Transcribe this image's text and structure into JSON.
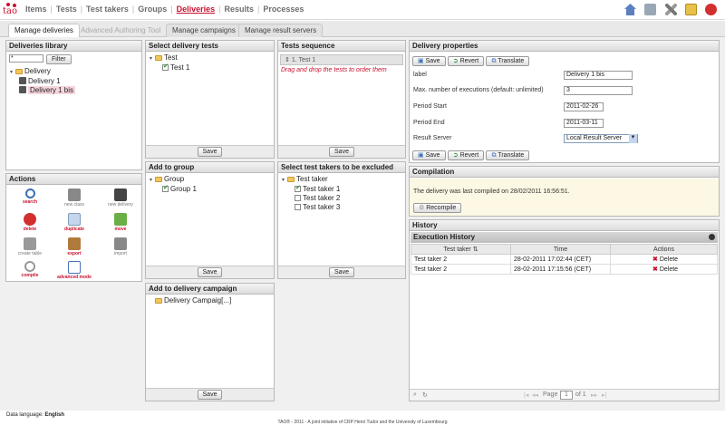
{
  "app": {
    "logo_text": "tao"
  },
  "nav": {
    "items": [
      "Items",
      "Tests",
      "Test takers",
      "Groups",
      "Deliveries",
      "Results",
      "Processes"
    ],
    "active": "Deliveries"
  },
  "toolbar_icons": [
    "home-icon",
    "user-settings-icon",
    "tools-icon",
    "notes-icon",
    "logout-icon"
  ],
  "tabs": [
    "Manage deliveries",
    "Advanced Authoring Tool",
    "Manage campaigns",
    "Manage result servers"
  ],
  "library": {
    "title": "Deliveries library",
    "filter_value": "*",
    "filter_label": "Filter",
    "root": "Delivery",
    "items": [
      "Delivery 1",
      "Delivery 1 bis"
    ]
  },
  "actions": {
    "title": "Actions",
    "items": [
      {
        "label": "search",
        "icon": "magnifier-icon"
      },
      {
        "label": "new class",
        "icon": "folder-icon"
      },
      {
        "label": "new delivery",
        "icon": "delivery-icon"
      },
      {
        "label": "delete",
        "icon": "delete-icon"
      },
      {
        "label": "duplicate",
        "icon": "duplicate-icon"
      },
      {
        "label": "move",
        "icon": "move-icon"
      },
      {
        "label": "create table",
        "icon": "table-icon"
      },
      {
        "label": "export",
        "icon": "export-icon"
      },
      {
        "label": "import",
        "icon": "import-icon"
      },
      {
        "label": "compile",
        "icon": "compile-icon"
      },
      {
        "label": "advanced mode",
        "icon": "advanced-mode-icon"
      }
    ]
  },
  "select_tests": {
    "title": "Select delivery tests",
    "folder": "Test",
    "items": [
      "Test 1"
    ],
    "save": "Save"
  },
  "tests_sequence": {
    "title": "Tests sequence",
    "item": "1. Test 1",
    "hint": "Drag and drop the tests to order them",
    "save": "Save"
  },
  "add_group": {
    "title": "Add to group",
    "folder": "Group",
    "items": [
      "Group 1"
    ],
    "save": "Save"
  },
  "exclude": {
    "title": "Select test takers to be excluded",
    "folder": "Test taker",
    "items": [
      "Test taker 1",
      "Test taker 2",
      "Test taker 3"
    ],
    "save": "Save"
  },
  "campaign": {
    "title": "Add to delivery campaign",
    "item": "Delivery Campaig[...]",
    "save": "Save"
  },
  "properties": {
    "title": "Delivery properties",
    "buttons": [
      "Save",
      "Revert",
      "Translate"
    ],
    "fields": [
      {
        "label": "label",
        "value": "Delivery 1 bis"
      },
      {
        "label": "Max. number of executions (default: unlimited)",
        "value": "3"
      },
      {
        "label": "Period Start",
        "value": "2011-02-26"
      },
      {
        "label": "Period End",
        "value": "2011-03-11"
      },
      {
        "label": "Result Server",
        "value": "Local Result Server"
      }
    ]
  },
  "compilation": {
    "title": "Compilation",
    "message": "The delivery was last compiled on 28/02/2011 16:56:51.",
    "button": "Recompile"
  },
  "history": {
    "title": "History",
    "grid_title": "Execution History",
    "columns": [
      "Test taker",
      "Time",
      "Actions"
    ],
    "rows": [
      {
        "taker": "Test taker 2",
        "time": "28-02-2011 17:02:44 (CET)",
        "action": "Delete"
      },
      {
        "taker": "Test taker 2",
        "time": "28-02-2011 17:15:56 (CET)",
        "action": "Delete"
      }
    ],
    "pager": {
      "page_label": "Page",
      "page": "1",
      "of_label": "of 1"
    }
  },
  "footer": {
    "lang_label": "Data language:",
    "lang": "English",
    "copyright": "TAO® - 2011 - A joint initiative of CRP Henri Tudor and the University of Luxembourg"
  },
  "colors": {
    "accent": "#c8102e",
    "panel_header": "#dcdcdc"
  }
}
